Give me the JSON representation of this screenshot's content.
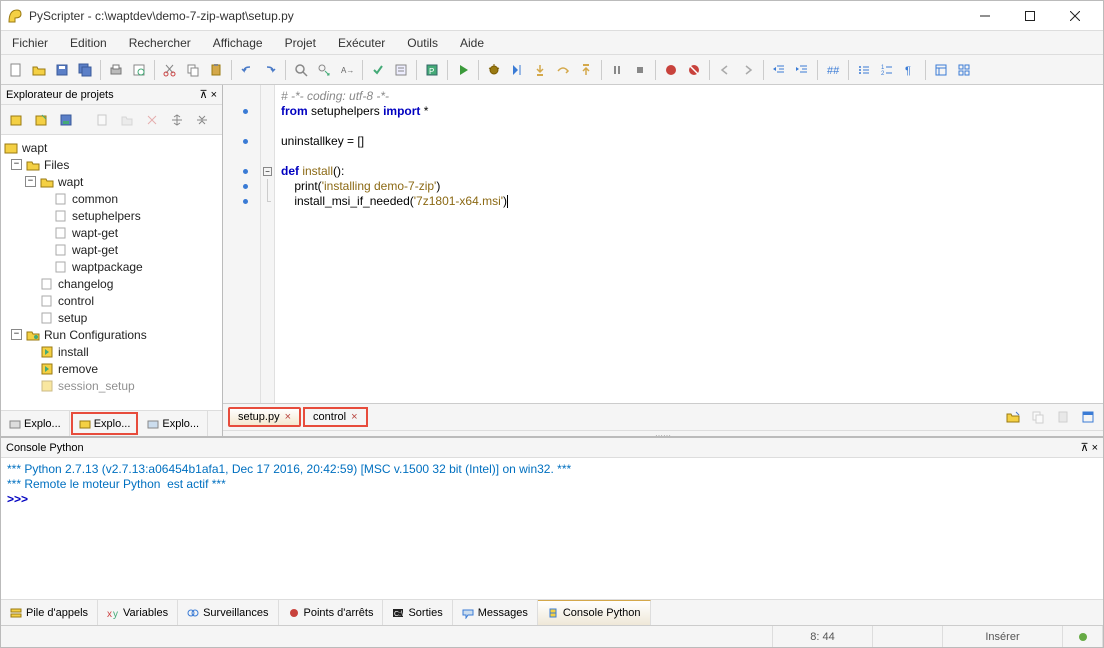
{
  "window": {
    "title": "PyScripter - c:\\waptdev\\demo-7-zip-wapt\\setup.py"
  },
  "menu": {
    "items": [
      "Fichier",
      "Edition",
      "Rechercher",
      "Affichage",
      "Projet",
      "Exécuter",
      "Outils",
      "Aide"
    ]
  },
  "project_panel": {
    "title": "Explorateur de projets",
    "tree": {
      "root": "wapt",
      "files_label": "Files",
      "wapt_folder": "wapt",
      "items": [
        "common",
        "setuphelpers",
        "wapt-get",
        "wapt-get",
        "waptpackage"
      ],
      "loose": [
        "changelog",
        "control",
        "setup"
      ],
      "run_cfg": "Run Configurations",
      "run_items": [
        "install",
        "remove",
        "session_setup"
      ]
    },
    "side_tabs": [
      "Explo...",
      "Explo...",
      "Explo..."
    ]
  },
  "editor": {
    "tabs": [
      {
        "label": "setup.py",
        "active": true
      },
      {
        "label": "control",
        "active": false
      }
    ],
    "code_lines": {
      "l1": "# -*- coding: utf-8 -*-",
      "l2_from": "from",
      "l2_mod": " setuphelpers ",
      "l2_import": "import",
      "l2_star": " *",
      "l4": "uninstallkey = []",
      "l6_def": "def",
      "l6_name": " install",
      "l6_rest": "():",
      "l7_a": "    print(",
      "l7_s": "'installing demo-7-zip'",
      "l7_b": ")",
      "l8_a": "    install_msi_if_needed(",
      "l8_s": "'7z1801-x64.msi'",
      "l8_b": ")"
    }
  },
  "console": {
    "title": "Console Python",
    "line1": "*** Python 2.7.13 (v2.7.13:a06454b1afa1, Dec 17 2016, 20:42:59) [MSC v.1500 32 bit (Intel)] on win32. ***",
    "line2": "*** Remote le moteur Python  est actif ***",
    "prompt": ">>> ",
    "tabs": [
      "Pile d'appels",
      "Variables",
      "Surveillances",
      "Points d'arrêts",
      "Sorties",
      "Messages",
      "Console Python"
    ]
  },
  "status": {
    "pos": "8: 44",
    "mode": "Insérer"
  }
}
